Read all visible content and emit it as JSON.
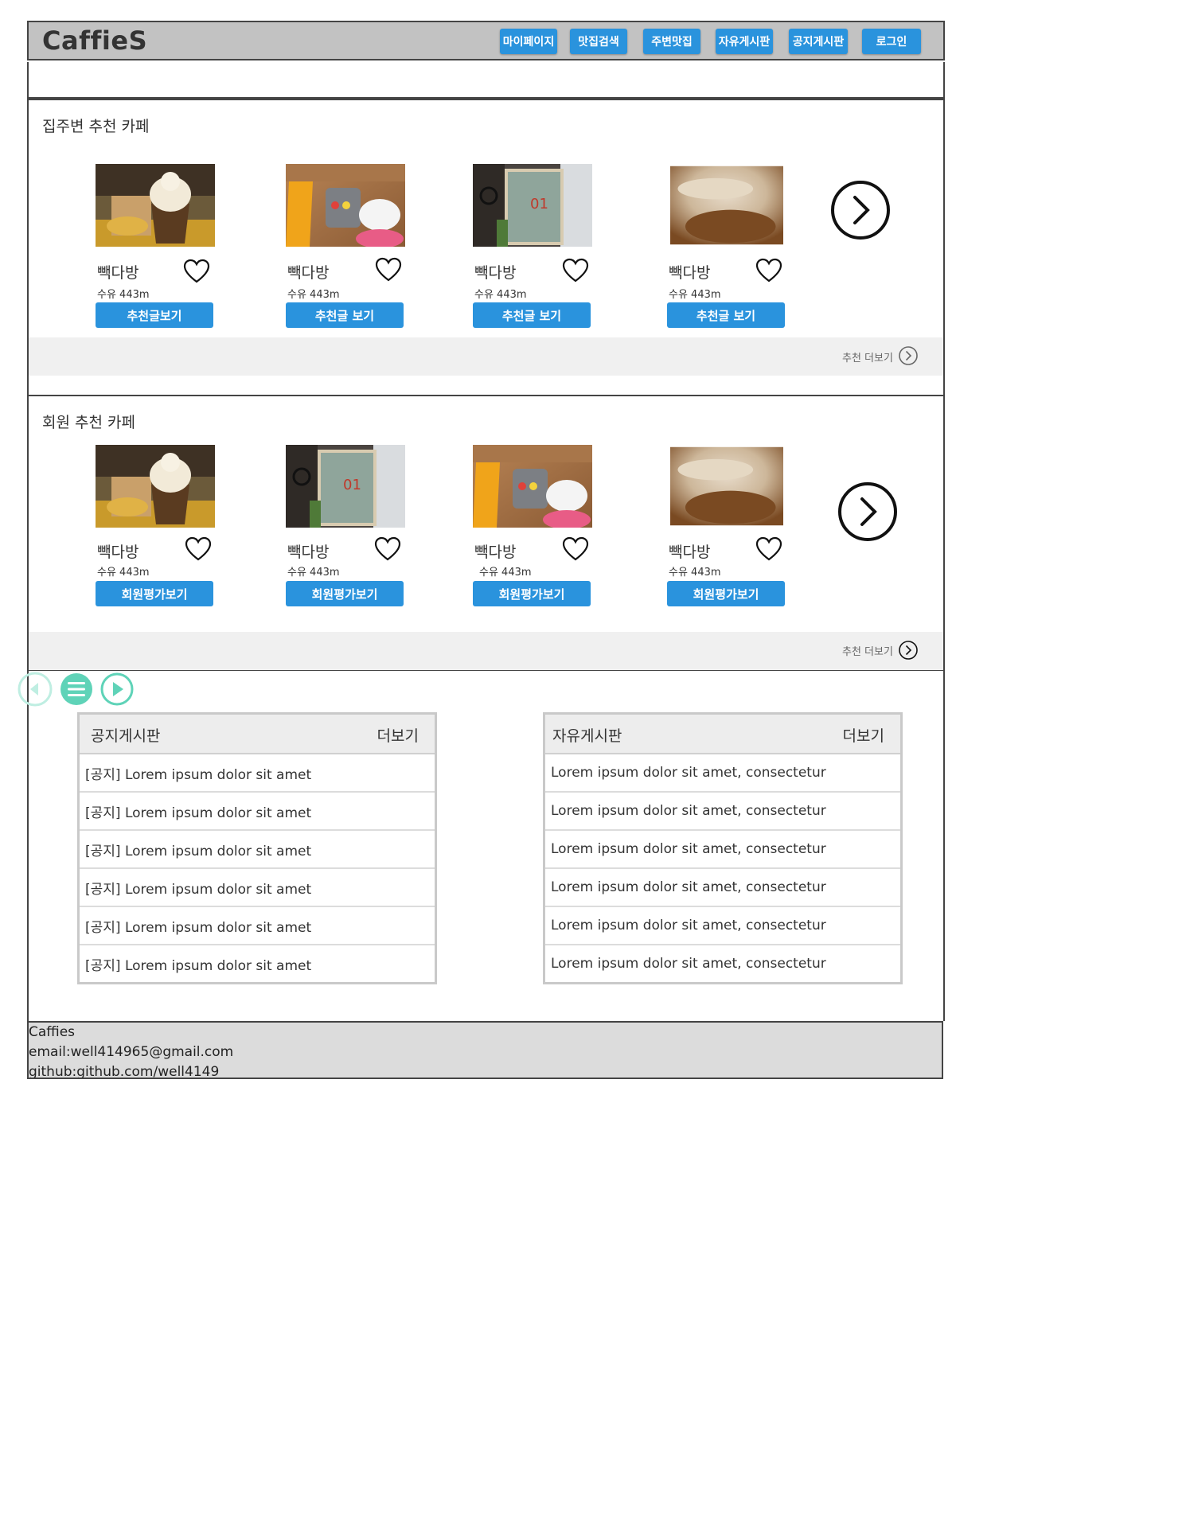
{
  "header": {
    "logo": "CaffieS",
    "nav": [
      "마이페이지",
      "맛집검색",
      "주변맛집",
      "자유게시판",
      "공지게시판",
      "로그인"
    ]
  },
  "nearby": {
    "title": "집주변 추천 카페",
    "cards": [
      {
        "name": "빽다방",
        "distance": "수유 443m",
        "button": "추천글보기",
        "image": "icecream-photo"
      },
      {
        "name": "빽다방",
        "distance": "수유 443m",
        "button": "추천글 보기",
        "image": "juice-photo"
      },
      {
        "name": "빽다방",
        "distance": "수유 443m",
        "button": "추천글 보기",
        "image": "cafe-door-photo"
      },
      {
        "name": "빽다방",
        "distance": "수유 443m",
        "button": "추천글 보기",
        "image": "coffee-foam-photo"
      }
    ],
    "more": "추천 더보기"
  },
  "members": {
    "title": "회원 추천 카페",
    "cards": [
      {
        "name": "빽다방",
        "distance": "수유 443m",
        "button": "회원평가보기",
        "image": "icecream-photo"
      },
      {
        "name": "빽다방",
        "distance": "수유 443m",
        "button": "회원평가보기",
        "image": "cafe-door-photo"
      },
      {
        "name": "빽다방",
        "distance": "수유 443m",
        "button": "회원평가보기",
        "image": "juice-photo"
      },
      {
        "name": "빽다방",
        "distance": "수유 443m",
        "button": "회원평가보기",
        "image": "coffee-foam-photo"
      }
    ],
    "more": "추천 더보기"
  },
  "controls": {
    "icons": [
      "previous-icon",
      "menu-icon",
      "play-icon"
    ],
    "accent": "#5fd3b8"
  },
  "notice_board": {
    "title": "공지게시판",
    "more": "더보기",
    "rows": [
      "[공지] Lorem ipsum dolor sit amet",
      "[공지] Lorem ipsum dolor sit amet",
      "[공지] Lorem ipsum dolor sit amet",
      "[공지] Lorem ipsum dolor sit amet",
      "[공지] Lorem ipsum dolor sit amet",
      "[공지] Lorem ipsum dolor sit amet"
    ]
  },
  "free_board": {
    "title": "자유게시판",
    "more": "더보기",
    "rows": [
      "Lorem ipsum dolor sit amet, consectetur",
      "Lorem ipsum dolor sit amet, consectetur",
      "Lorem ipsum dolor sit amet, consectetur",
      "Lorem ipsum dolor sit amet, consectetur",
      "Lorem ipsum dolor sit amet, consectetur",
      "Lorem ipsum dolor sit amet, consectetur"
    ]
  },
  "footer": {
    "name": "Caffies",
    "email": "email:well414965@gmail.com",
    "github": "github:github.com/well4149"
  },
  "colors": {
    "button": "#2a93dd",
    "header_bg": "#c2c2c2",
    "footer_bg": "#dcdcdc"
  }
}
